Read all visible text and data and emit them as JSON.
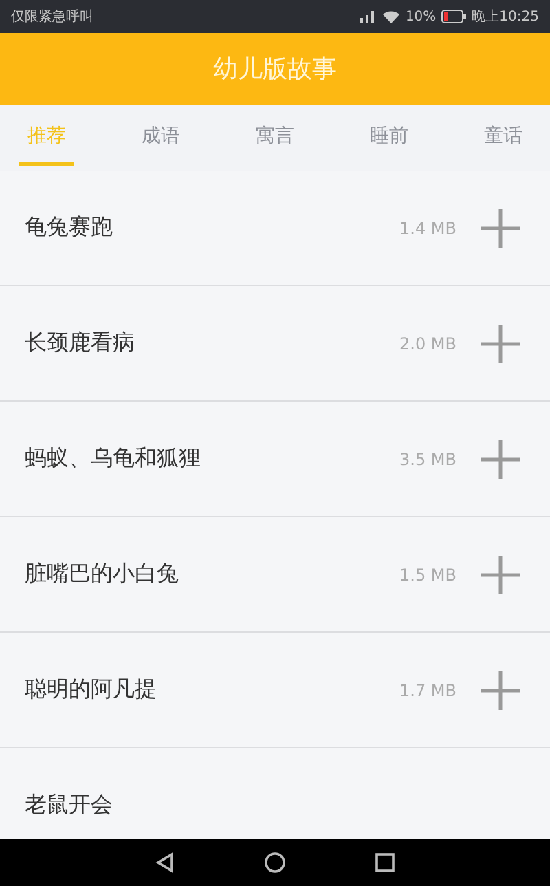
{
  "status_bar": {
    "carrier": "仅限紧急呼叫",
    "battery": "10%",
    "time": "晚上10:25"
  },
  "header": {
    "title": "幼儿版故事"
  },
  "tabs": [
    {
      "label": "推荐",
      "selected": true
    },
    {
      "label": "成语",
      "selected": false
    },
    {
      "label": "寓言",
      "selected": false
    },
    {
      "label": "睡前",
      "selected": false
    },
    {
      "label": "童话",
      "selected": false
    }
  ],
  "stories": [
    {
      "title": "龟兔赛跑",
      "size": "1.4 MB"
    },
    {
      "title": "长颈鹿看病",
      "size": "2.0 MB"
    },
    {
      "title": "蚂蚁、乌龟和狐狸",
      "size": "3.5 MB"
    },
    {
      "title": "脏嘴巴的小白兔",
      "size": "1.5 MB"
    },
    {
      "title": "聪明的阿凡提",
      "size": "1.7 MB"
    },
    {
      "title": "老鼠开会"
    }
  ]
}
